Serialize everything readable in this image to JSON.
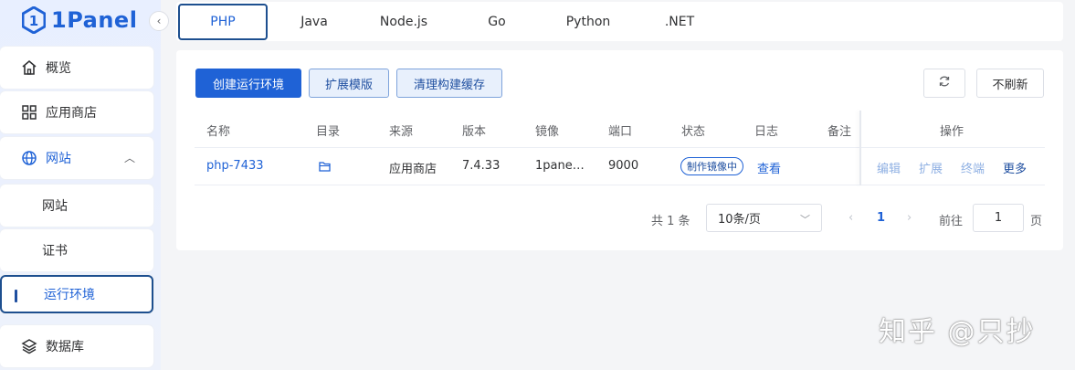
{
  "app": {
    "logo_text": "1Panel"
  },
  "sidebar": {
    "items": [
      {
        "label": "概览",
        "icon": "home-icon"
      },
      {
        "label": "应用商店",
        "icon": "grid-icon"
      },
      {
        "label": "网站",
        "icon": "globe-icon",
        "expanded": true
      },
      {
        "label": "网站",
        "sub": true
      },
      {
        "label": "证书",
        "sub": true
      },
      {
        "label": "运行环境",
        "sub": true,
        "active": true
      },
      {
        "label": "数据库",
        "icon": "layers-icon"
      }
    ]
  },
  "tabs": [
    {
      "label": "PHP",
      "active": true
    },
    {
      "label": "Java"
    },
    {
      "label": "Node.js"
    },
    {
      "label": "Go"
    },
    {
      "label": "Python"
    },
    {
      "label": ".NET"
    }
  ],
  "toolbar": {
    "create_label": "创建运行环境",
    "extend_template_label": "扩展模版",
    "clear_cache_label": "清理构建缓存",
    "no_refresh_label": "不刷新"
  },
  "table": {
    "columns": [
      "名称",
      "目录",
      "来源",
      "版本",
      "镜像",
      "端口",
      "状态",
      "日志",
      "备注",
      "操作"
    ],
    "rows": [
      {
        "name": "php-7433",
        "source": "应用商店",
        "version": "7.4.33",
        "image": "1pane…",
        "port": "9000",
        "status": "制作镜像中",
        "log": "查看",
        "remark": "",
        "actions": {
          "edit": "编辑",
          "extend": "扩展",
          "terminal": "终端",
          "more": "更多"
        }
      }
    ]
  },
  "pagination": {
    "total_text": "共 1 条",
    "page_size": "10条/页",
    "current_page": "1",
    "goto_label": "前往",
    "goto_value": "1",
    "page_suffix": "页"
  },
  "watermark": "知乎 @只抄",
  "colors": {
    "primary": "#1f62d6",
    "active_border": "#1d4f8f",
    "sidebar_bg": "#e8efff"
  }
}
